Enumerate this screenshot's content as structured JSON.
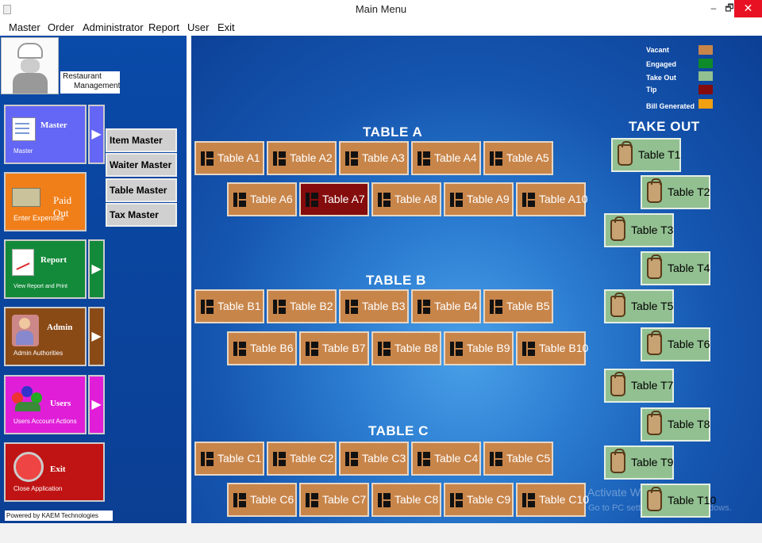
{
  "window": {
    "title": "Main Menu",
    "minimize": "–",
    "maximize": "🗗",
    "close": "✕"
  },
  "menu": [
    "Master",
    "Order",
    "Administrator",
    "Report",
    "User",
    "Exit"
  ],
  "logo": {
    "line1": "Restaurant",
    "line2": "Management"
  },
  "sidebar": [
    {
      "title": "Master",
      "subtitle": "Master",
      "color": "#6466f5",
      "arrow": "▶"
    },
    {
      "title": "Paid Out",
      "subtitle": "Enter Expenses",
      "color": "#f07f1a",
      "arrow": ""
    },
    {
      "title": "Report",
      "subtitle": "View Report and Print",
      "color": "#138a3a",
      "arrow": "▶"
    },
    {
      "title": "Admin",
      "subtitle": "Admin Authorities",
      "color": "#8a4a16",
      "arrow": "▶"
    },
    {
      "title": "Users",
      "subtitle": "Users Account Actions",
      "color": "#e01ed8",
      "arrow": "▶"
    },
    {
      "title": "Exit",
      "subtitle": "Close Application",
      "color": "#c01414",
      "arrow": ""
    }
  ],
  "submenu": [
    "Item Master",
    "Waiter Master",
    "Table Master",
    "Tax Master"
  ],
  "powered": "Powered by KAEM Technologies Group",
  "sections": {
    "a": "TABLE  A",
    "b": "TABLE  B",
    "c": "TABLE  C",
    "takeout": "TAKE OUT"
  },
  "tables_a": [
    "Table A1",
    "Table A2",
    "Table A3",
    "Table A4",
    "Table A5",
    "Table A6",
    "Table A7",
    "Table A8",
    "Table A9",
    "Table A10"
  ],
  "tables_b": [
    "Table B1",
    "Table B2",
    "Table B3",
    "Table B4",
    "Table B5",
    "Table B6",
    "Table B7",
    "Table B8",
    "Table B9",
    "Table B10"
  ],
  "tables_c": [
    "Table C1",
    "Table C2",
    "Table C3",
    "Table C4",
    "Table C5",
    "Table C6",
    "Table C7",
    "Table C8",
    "Table C9",
    "Table C10"
  ],
  "takeout": [
    "Table T1",
    "Table T2",
    "Table T3",
    "Table T4",
    "Table T5",
    "Table T6",
    "Table T7",
    "Table T8",
    "Table T9",
    "Table T10"
  ],
  "table_status": {
    "Table A7": "Tip"
  },
  "legend": [
    {
      "label": "Vacant",
      "color": "#c8854a"
    },
    {
      "label": "Engaged",
      "color": "#0f8a2a"
    },
    {
      "label": "Take Out",
      "color": "#92c091"
    },
    {
      "label": "Tip",
      "color": "#850c0c"
    },
    {
      "label": "Bill Generated",
      "color": "#f0a010"
    }
  ],
  "watermark": {
    "line1": "Activate W",
    "line2": "Go to PC setti",
    "line3": "dows."
  }
}
